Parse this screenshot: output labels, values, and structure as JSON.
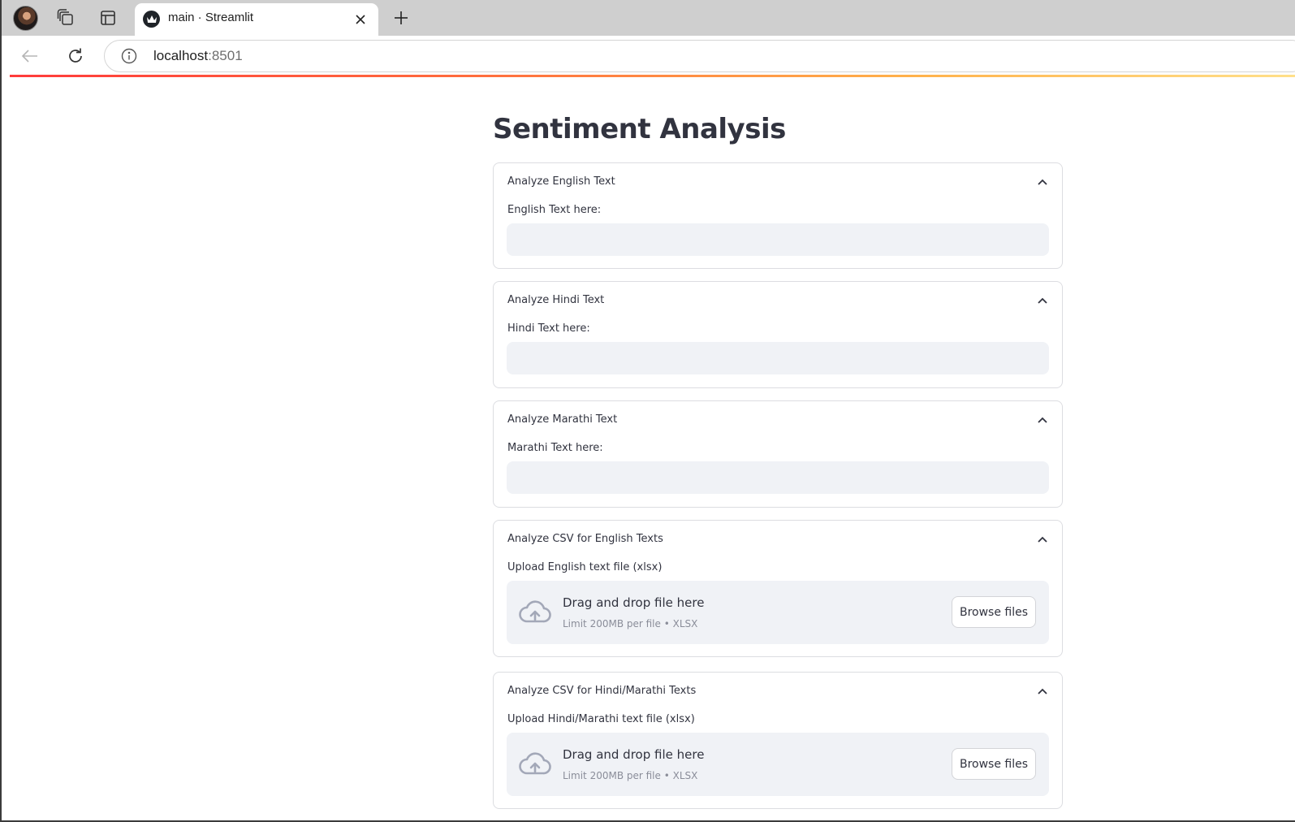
{
  "browser": {
    "tab_title": "main · Streamlit",
    "url_host": "localhost",
    "url_port": ":8501"
  },
  "page": {
    "title": "Sentiment Analysis"
  },
  "sections": {
    "english": {
      "header": "Analyze English Text",
      "label": "English Text here:",
      "value": ""
    },
    "hindi": {
      "header": "Analyze Hindi Text",
      "label": "Hindi Text here:",
      "value": ""
    },
    "marathi": {
      "header": "Analyze Marathi Text",
      "label": "Marathi Text here:",
      "value": ""
    },
    "csv_english": {
      "header": "Analyze CSV for English Texts",
      "label": "Upload English text file (xlsx)",
      "drop_text": "Drag and drop file here",
      "limit_text": "Limit 200MB per file • XLSX",
      "button": "Browse files"
    },
    "csv_hindi_marathi": {
      "header": "Analyze CSV for Hindi/Marathi Texts",
      "label": "Upload Hindi/Marathi text file (xlsx)",
      "drop_text": "Drag and drop file here",
      "limit_text": "Limit 200MB per file • XLSX",
      "button": "Browse files"
    }
  },
  "colors": {
    "text": "#31333f",
    "input_bg": "#f0f2f6",
    "border": "#dcdde1",
    "muted": "#8a8d99",
    "cloud_icon": "#a3a8b8"
  },
  "icons": {
    "profile": "profile-avatar",
    "workspaces": "workspaces-icon",
    "tab_actions": "tab-actions-icon",
    "favicon": "streamlit-crown-icon",
    "close": "close-icon",
    "new_tab": "plus-icon",
    "back": "back-arrow-icon",
    "reload": "reload-icon",
    "site_info": "info-icon",
    "expander": "chevron-up-icon",
    "upload": "cloud-upload-icon"
  }
}
